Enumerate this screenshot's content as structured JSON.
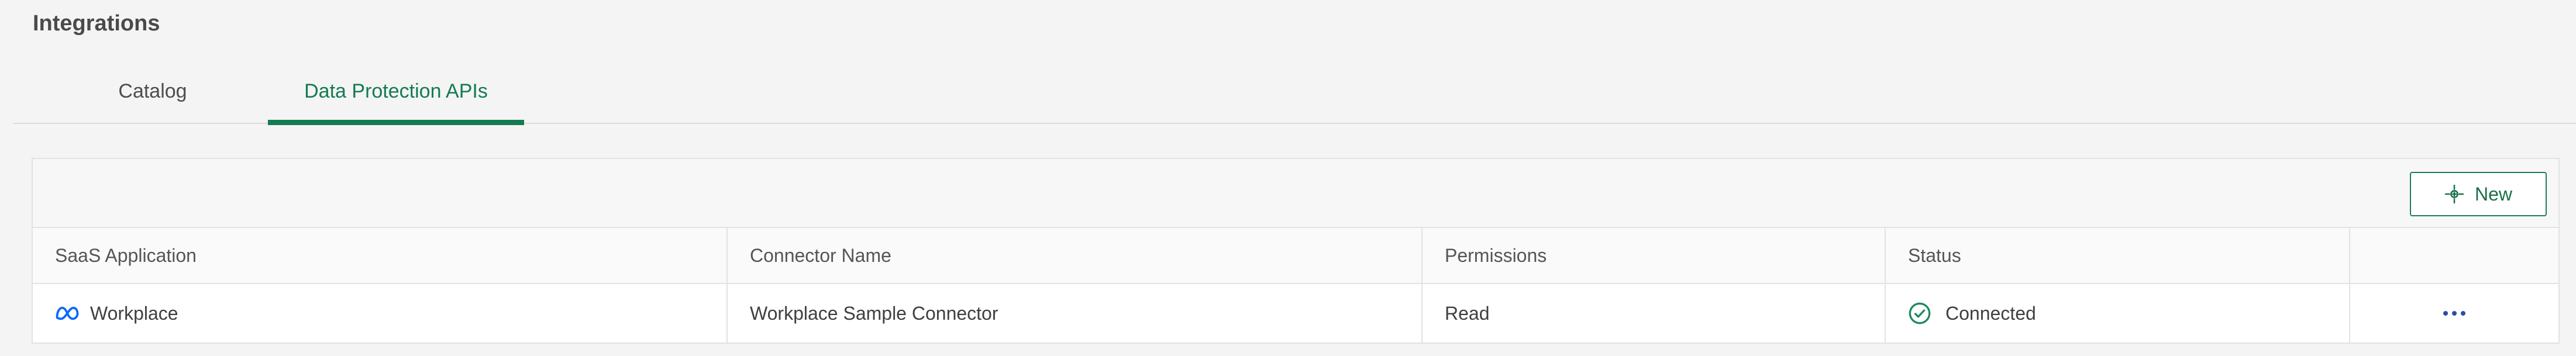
{
  "page": {
    "title": "Integrations"
  },
  "tabs": [
    {
      "label": "Catalog",
      "active": false
    },
    {
      "label": "Data Protection APIs",
      "active": true
    }
  ],
  "toolbar": {
    "new_label": "New",
    "new_icon": "crosshair-plus-icon"
  },
  "table": {
    "columns": [
      "SaaS Application",
      "Connector Name",
      "Permissions",
      "Status",
      ""
    ],
    "rows": [
      {
        "app": "Workplace",
        "app_icon": "meta-logo-icon",
        "connector": "Workplace Sample Connector",
        "permissions": "Read",
        "status": "Connected",
        "status_icon": "check-circle-icon",
        "actions_icon": "more-horizontal-icon"
      }
    ]
  },
  "colors": {
    "accent": "#137b51",
    "status_connected": "#1f8a5b",
    "meta_blue": "#0866ff",
    "more_icon": "#2a4fa3"
  }
}
